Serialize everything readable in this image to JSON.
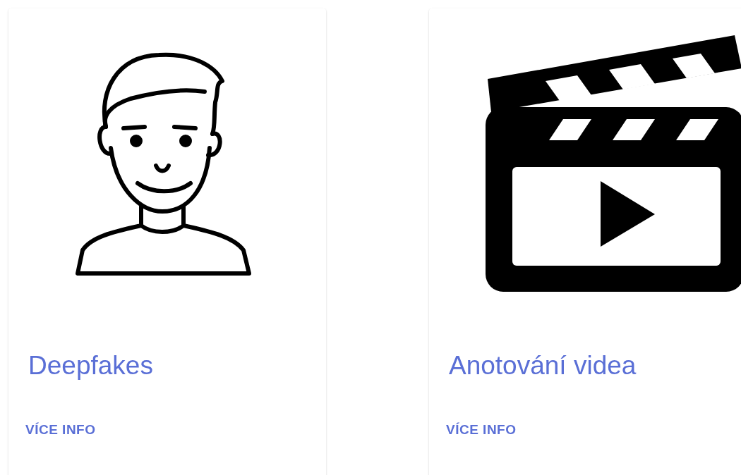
{
  "cards": [
    {
      "kind": "person",
      "title": "Deepfakes",
      "action": "VÍCE INFO"
    },
    {
      "kind": "clapperboard",
      "title": "Anotování videa",
      "action": "VÍCE INFO"
    }
  ]
}
